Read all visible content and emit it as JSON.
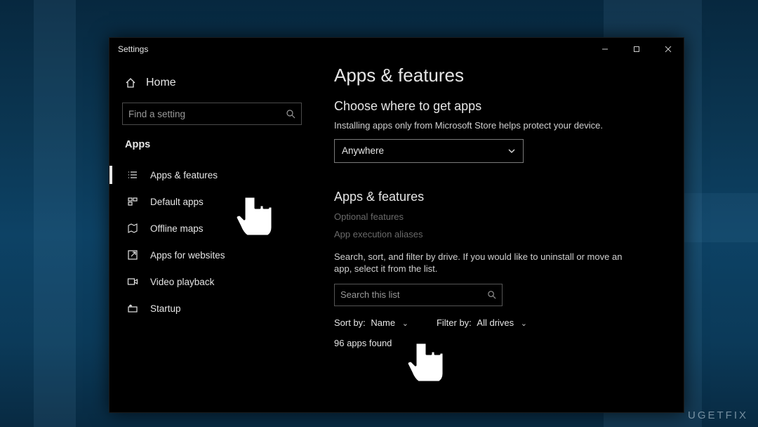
{
  "window": {
    "title": "Settings",
    "controls": {
      "minimize": "—",
      "maximize": "▢",
      "close": "✕"
    }
  },
  "sidebar": {
    "home_label": "Home",
    "search_placeholder": "Find a setting",
    "section": "Apps",
    "items": [
      {
        "label": "Apps & features"
      },
      {
        "label": "Default apps"
      },
      {
        "label": "Offline maps"
      },
      {
        "label": "Apps for websites"
      },
      {
        "label": "Video playback"
      },
      {
        "label": "Startup"
      }
    ]
  },
  "main": {
    "page_title": "Apps & features",
    "choose_heading": "Choose where to get apps",
    "choose_help": "Installing apps only from Microsoft Store helps protect your device.",
    "source_selected": "Anywhere",
    "section_heading": "Apps & features",
    "link_optional": "Optional features",
    "link_aliases": "App execution aliases",
    "list_help": "Search, sort, and filter by drive. If you would like to uninstall or move an app, select it from the list.",
    "list_search_placeholder": "Search this list",
    "sort_label": "Sort by:",
    "sort_value": "Name",
    "filter_label": "Filter by:",
    "filter_value": "All drives",
    "apps_found": "96 apps found"
  },
  "watermark": "UGETFIX"
}
